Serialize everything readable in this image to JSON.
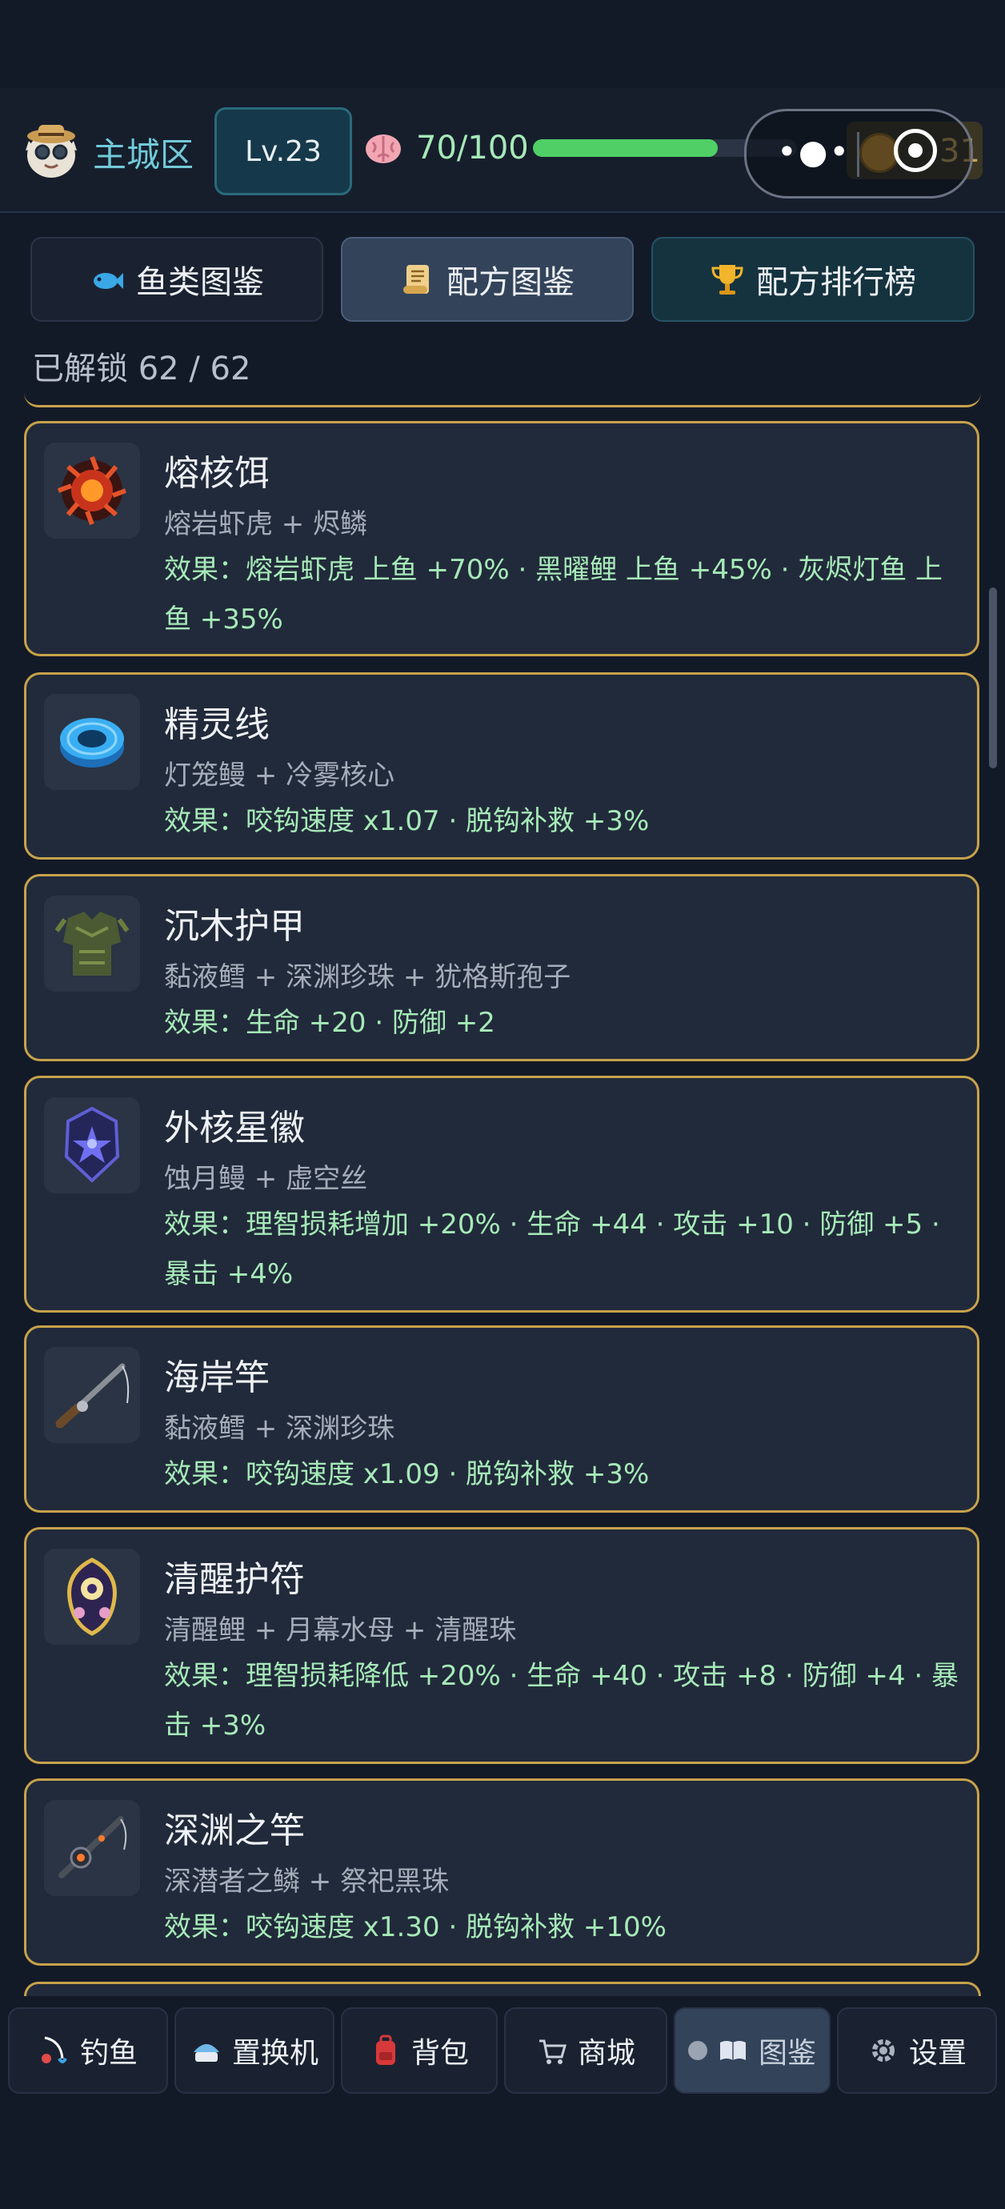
{
  "header": {
    "zone": "主城区",
    "level": "Lv.23",
    "sanity_text": "70/100",
    "sanity_fraction": 0.7,
    "coins": "31"
  },
  "tabs": [
    {
      "label": "鱼类图鉴",
      "icon": "fish-icon"
    },
    {
      "label": "配方图鉴",
      "icon": "scroll-icon"
    },
    {
      "label": "配方排行榜",
      "icon": "trophy-icon"
    }
  ],
  "unlock_text": "已解锁 62 / 62",
  "recipes": [
    {
      "name": "熔核饵",
      "ingredients": "熔岩虾虎 + 烬鳞",
      "effect": "效果：熔岩虾虎 上鱼 +70% · 黑曜鲤 上鱼 +45% · 灰烬灯鱼 上鱼 +35%",
      "icon": "magma-core-icon"
    },
    {
      "name": "精灵线",
      "ingredients": "灯笼鳗 + 冷雾核心",
      "effect": "效果：咬钩速度 x1.07 · 脱钩补救 +3%",
      "icon": "spirit-line-icon"
    },
    {
      "name": "沉木护甲",
      "ingredients": "黏液鳕 + 深渊珍珠 + 犹格斯孢子",
      "effect": "效果：生命 +20 · 防御 +2",
      "icon": "driftwood-armor-icon"
    },
    {
      "name": "外核星徽",
      "ingredients": "蚀月鳗 + 虚空丝",
      "effect": "效果：理智损耗增加 +20% · 生命 +44 · 攻击 +10 · 防御 +5 · 暴击 +4%",
      "icon": "star-emblem-icon"
    },
    {
      "name": "海岸竿",
      "ingredients": "黏液鳕 + 深渊珍珠",
      "effect": "效果：咬钩速度 x1.09 · 脱钩补救 +3%",
      "icon": "coast-rod-icon"
    },
    {
      "name": "清醒护符",
      "ingredients": "清醒鲤 + 月幕水母 + 清醒珠",
      "effect": "效果：理智损耗降低 +20% · 生命 +40 · 攻击 +8 · 防御 +4 · 暴击 +3%",
      "icon": "amulet-icon"
    },
    {
      "name": "深渊之竿",
      "ingredients": "深潜者之鳞 + 祭祀黑珠",
      "effect": "效果：咬钩速度 x1.30 · 脱钩补救 +10%",
      "icon": "abyss-rod-icon"
    }
  ],
  "nav": [
    {
      "label": "钓鱼",
      "icon": "fishing-icon"
    },
    {
      "label": "置换机",
      "icon": "machine-icon"
    },
    {
      "label": "背包",
      "icon": "backpack-icon"
    },
    {
      "label": "商城",
      "icon": "cart-icon"
    },
    {
      "label": "图鉴",
      "icon": "book-icon"
    },
    {
      "label": "设置",
      "icon": "gear-icon"
    }
  ],
  "colors": {
    "accent_gold": "#c7a24b",
    "effect_green": "#a6e9b8",
    "bar_green": "#4fcf66"
  }
}
